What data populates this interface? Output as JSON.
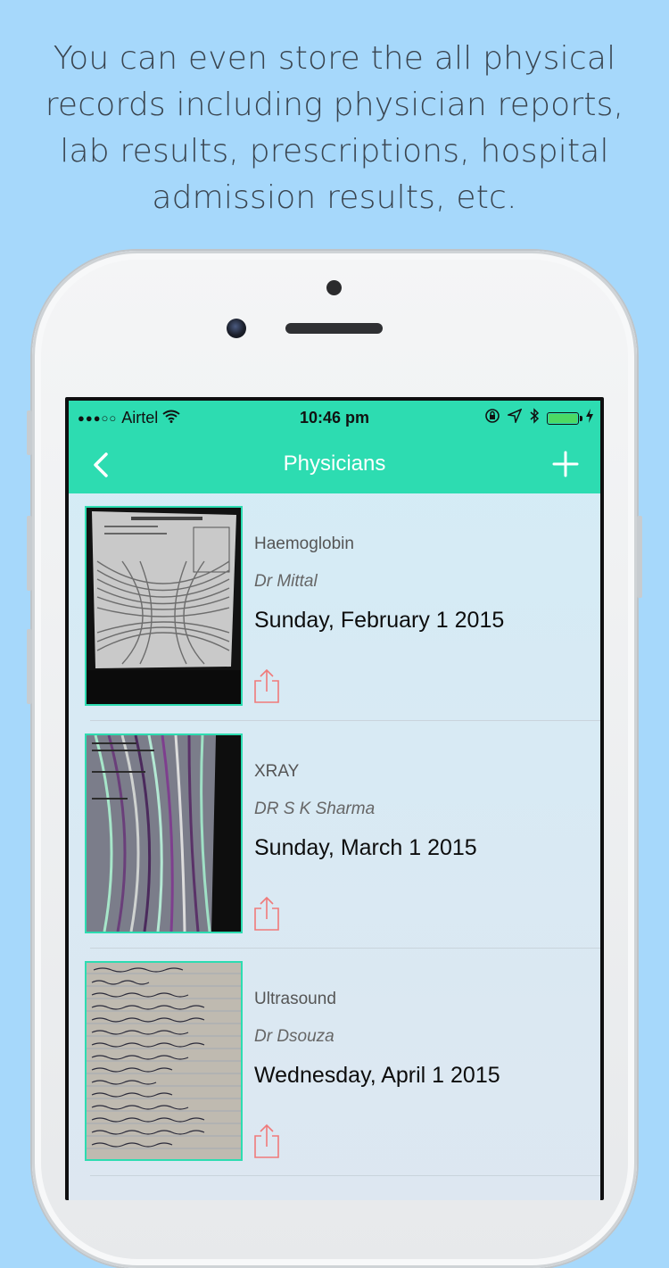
{
  "caption": "You can even store the all physical records including physician reports, lab results, prescriptions, hospital admission results, etc.",
  "status_bar": {
    "signal": "●●●○○",
    "carrier": "Airtel",
    "time": "10:46 pm"
  },
  "nav": {
    "title": "Physicians",
    "back_icon": "chevron-left-icon",
    "add_icon": "plus-icon"
  },
  "colors": {
    "accent": "#2ddcb1",
    "background": "#a6d8fb",
    "share_icon": "#f07a7a"
  },
  "records": [
    {
      "type": "Haemoglobin",
      "doctor": "Dr Mittal",
      "date": "Sunday, February 1 2015"
    },
    {
      "type": "XRAY",
      "doctor": "DR S K Sharma",
      "date": "Sunday, March 1 2015"
    },
    {
      "type": "Ultrasound",
      "doctor": "Dr Dsouza",
      "date": "Wednesday, April 1 2015"
    }
  ]
}
